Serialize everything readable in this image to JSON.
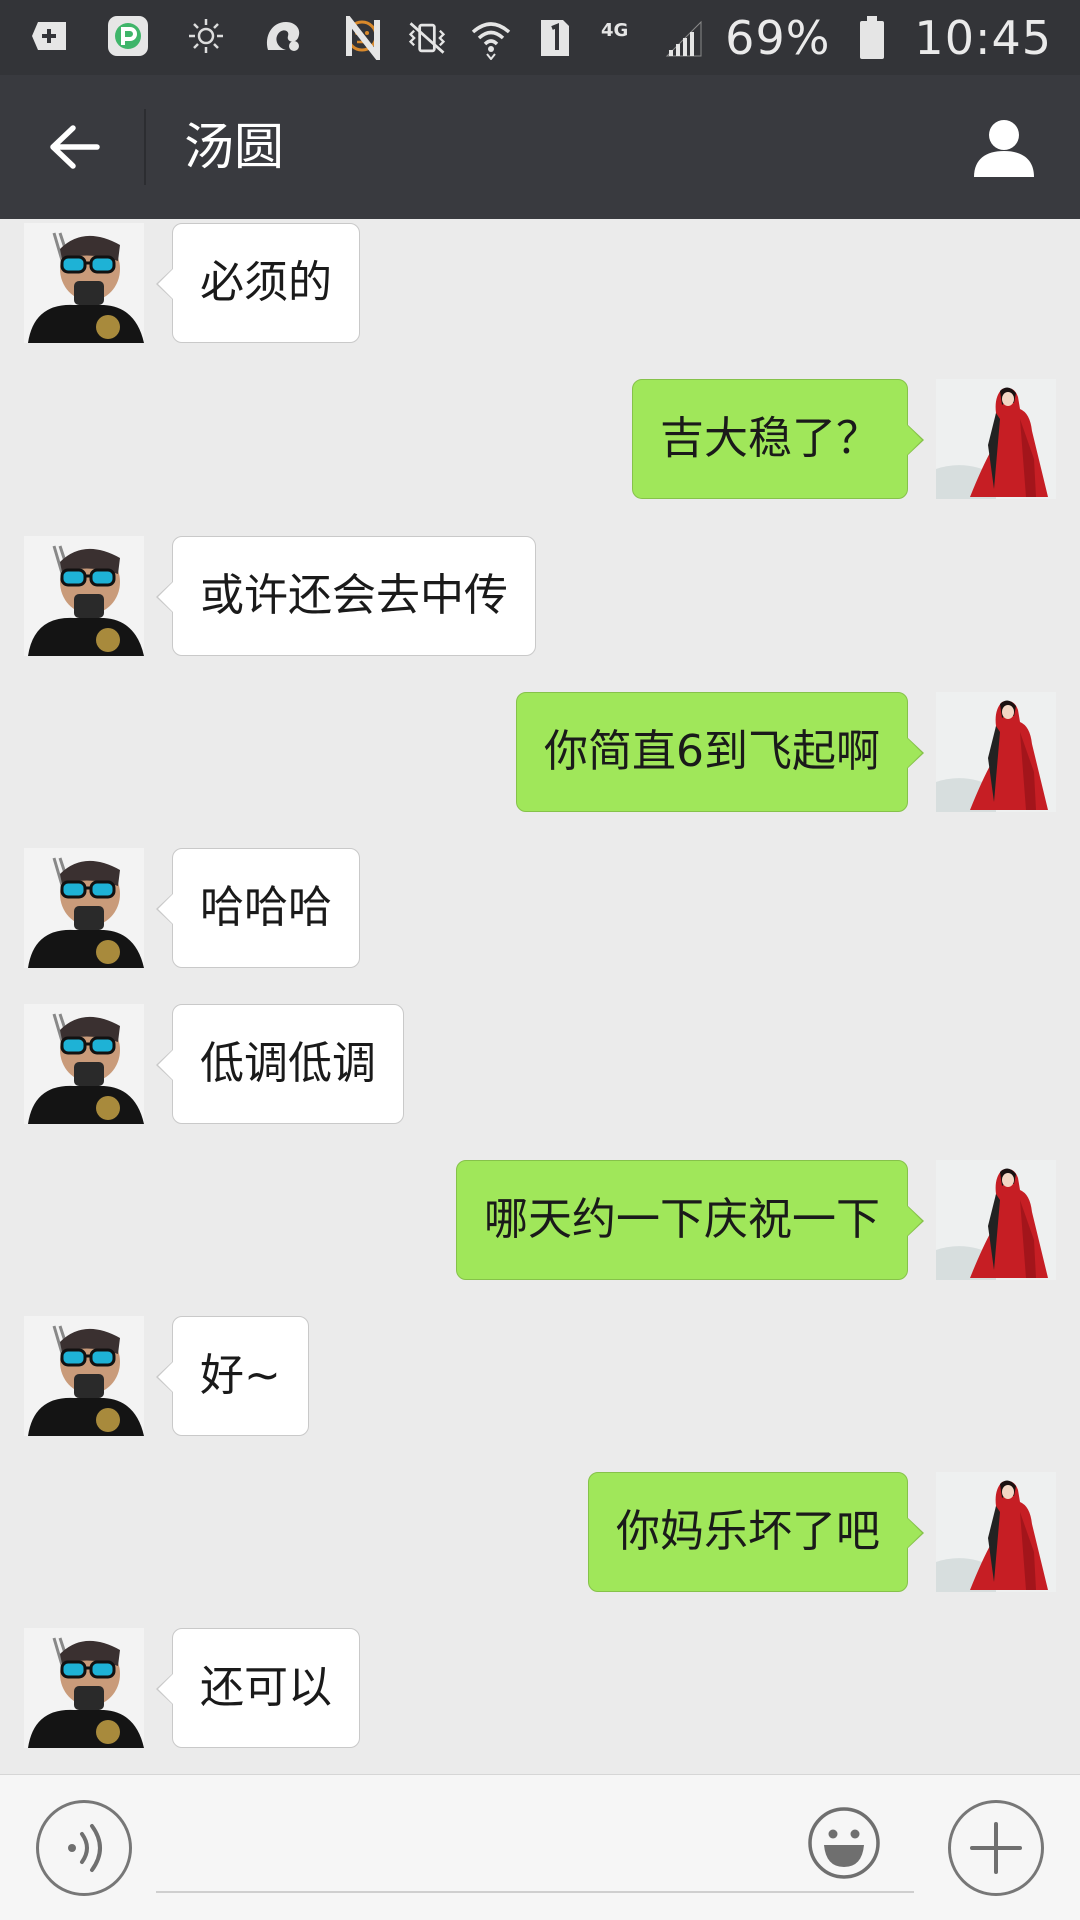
{
  "status_bar": {
    "battery_text": "69%",
    "time": "10:45",
    "left_icons": [
      "add-box-icon",
      "p-app-icon",
      "brightness-icon",
      "squirrel-browser-icon",
      "face-icon"
    ],
    "right_icons": [
      "nfc-icon",
      "vibrate-icon",
      "wifi-icon",
      "sim-1-icon",
      "4g-icon",
      "signal-icon",
      "battery-icon"
    ]
  },
  "title_bar": {
    "title": "汤圆"
  },
  "colors": {
    "status_bar_bg": "#333438",
    "title_bar_bg": "#393a3f",
    "chat_bg": "#ebebeb",
    "incoming_bubble": "#ffffff",
    "outgoing_bubble": "#a0e75a"
  },
  "messages": [
    {
      "side": "in",
      "text": "必须的"
    },
    {
      "side": "out",
      "text": "吉大稳了？"
    },
    {
      "side": "in",
      "text": "或许还会去中传"
    },
    {
      "side": "out",
      "text": "你简直6到飞起啊"
    },
    {
      "side": "in",
      "text": "哈哈哈"
    },
    {
      "side": "in",
      "text": "低调低调"
    },
    {
      "side": "out",
      "text": "哪天约一下庆祝一下"
    },
    {
      "side": "in",
      "text": "好~"
    },
    {
      "side": "out",
      "text": "你妈乐坏了吧"
    },
    {
      "side": "in",
      "text": "还可以"
    }
  ],
  "input_bar": {
    "placeholder": "",
    "value": ""
  }
}
